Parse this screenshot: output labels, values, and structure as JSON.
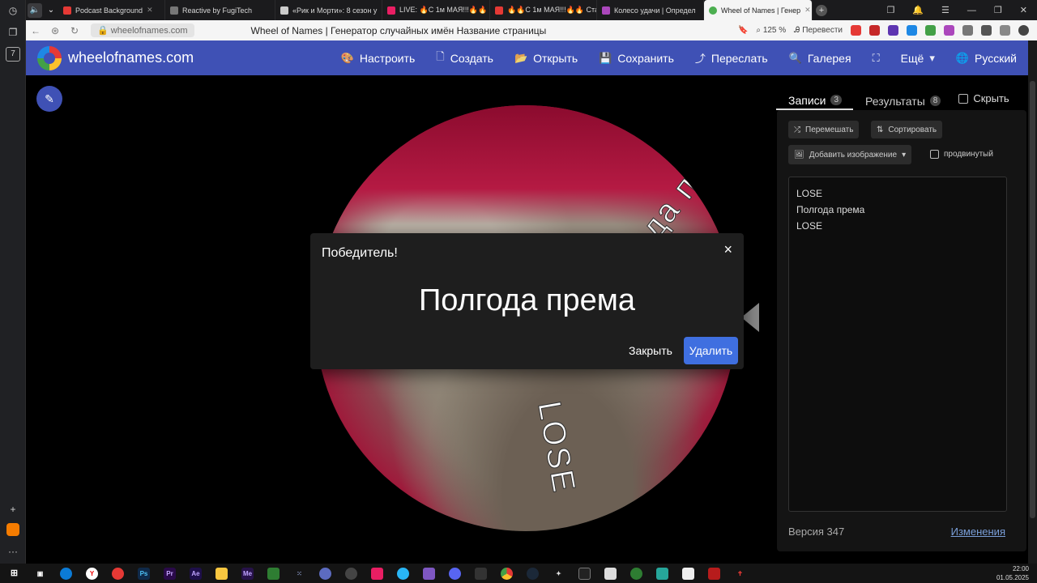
{
  "browser": {
    "tabs": [
      {
        "title": "Podcast Background",
        "color": "#e53935",
        "active": false
      },
      {
        "title": "Reactive by FugiTech",
        "color": "#777777",
        "active": false
      },
      {
        "title": "«Рик и Морти»: 8 сезон у",
        "color": "#cccccc",
        "active": false
      },
      {
        "title": "LIVE: 🔥С 1м МАЯ!!!🔥🔥",
        "color": "#e91e63",
        "active": false
      },
      {
        "title": "🔥🔥С 1м МАЯ!!!🔥🔥 Ста",
        "color": "#e53935",
        "active": false
      },
      {
        "title": "Колесо удачи | Определ",
        "color": "#ab47bc",
        "active": false
      },
      {
        "title": "Wheel of Names | Генер",
        "color": "#4caf50",
        "active": true
      }
    ],
    "url": "wheelofnames.com",
    "page_title": "Wheel of Names | Генератор случайных имён Название страницы",
    "zoom": "125 %",
    "translate": "Перевести"
  },
  "header": {
    "site_name": "wheelofnames.com",
    "menu": [
      {
        "label": "Настроить",
        "icon": "palette-icon",
        "glyph": "🎨"
      },
      {
        "label": "Создать",
        "icon": "file-icon",
        "glyph": "🗋"
      },
      {
        "label": "Открыть",
        "icon": "folder-icon",
        "glyph": "📂"
      },
      {
        "label": "Сохранить",
        "icon": "save-icon",
        "glyph": "💾"
      },
      {
        "label": "Переслать",
        "icon": "share-icon",
        "glyph": "⤴"
      },
      {
        "label": "Галерея",
        "icon": "search-icon",
        "glyph": "🔍"
      },
      {
        "label": "",
        "icon": "fullscreen-icon",
        "glyph": "⛶"
      },
      {
        "label": "Ещё",
        "icon": "chevron-down-icon",
        "glyph": "▾"
      },
      {
        "label": "Русский",
        "icon": "globe-icon",
        "glyph": "🌐"
      }
    ]
  },
  "wheel": {
    "labels": [
      "Полгода према",
      "LOSE"
    ]
  },
  "dialog": {
    "title": "Победитель!",
    "winner": "Полгода према",
    "close_label": "Закрыть",
    "delete_label": "Удалить",
    "close_icon": "×"
  },
  "panel": {
    "tab_entries": "Записи",
    "tab_entries_count": "3",
    "tab_results": "Результаты",
    "tab_results_count": "8",
    "hide_label": "Скрыть",
    "shuffle_label": "Перемешать",
    "sort_label": "Сортировать",
    "add_image_label": "Добавить изображение",
    "advanced_label": "продвинутый",
    "entries": [
      "LOSE",
      "Полгода према",
      "LOSE"
    ],
    "version": "Версия 347",
    "changes": "Изменения"
  },
  "taskbar": {
    "time": "22:00",
    "date": "01.05.2025"
  },
  "colors": {
    "header_bg": "#3f51b5",
    "delete_button": "#3f6fe0",
    "wheel_red": "#a01639"
  }
}
